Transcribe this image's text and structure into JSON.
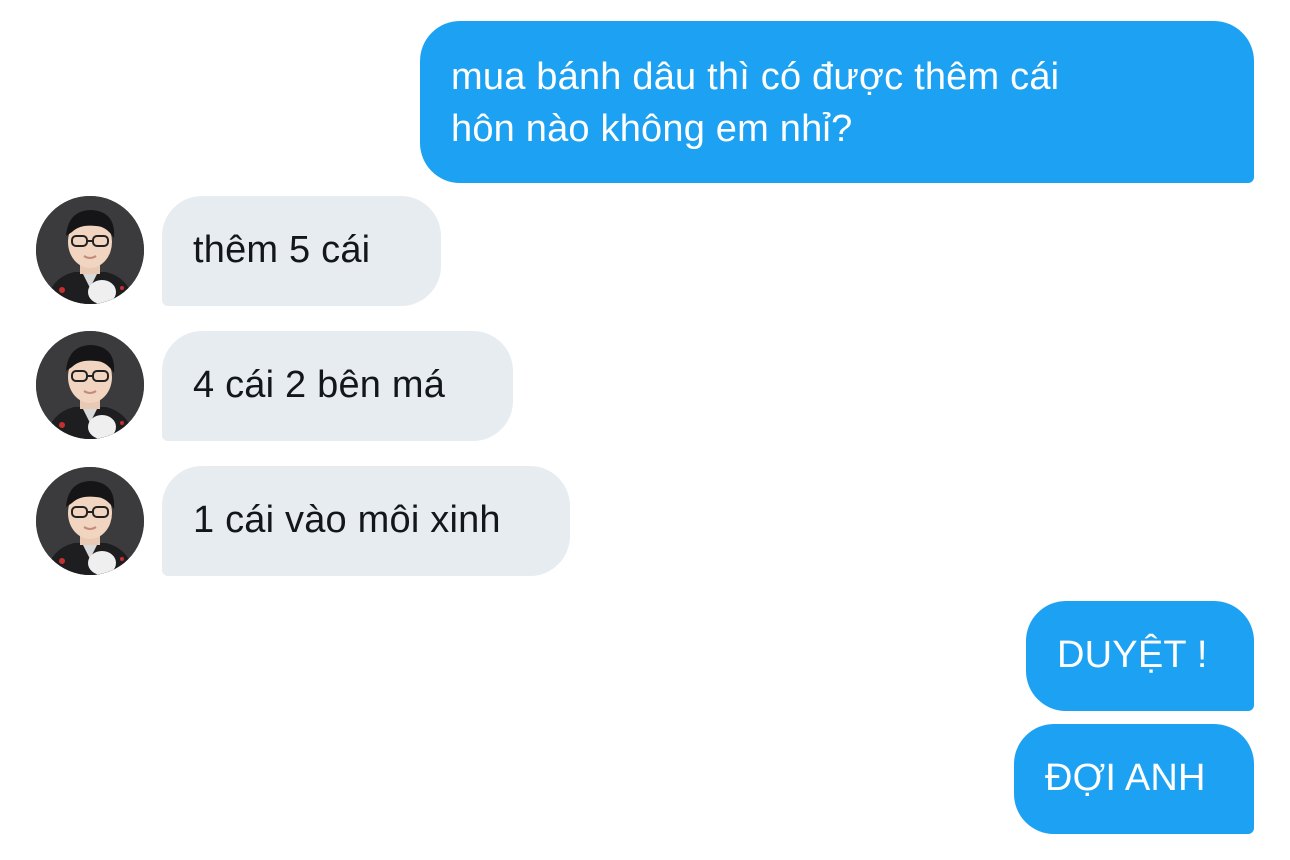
{
  "conversation": {
    "messages": [
      {
        "id": "m1",
        "sender": "me",
        "text_lines": [
          "mua bánh dâu thì có được thêm cái",
          "hôn nào không em nhỉ?"
        ]
      },
      {
        "id": "m2",
        "sender": "other",
        "text": "thêm 5 cái",
        "avatar_icon": "user-avatar"
      },
      {
        "id": "m3",
        "sender": "other",
        "text": "4 cái 2 bên má",
        "avatar_icon": "user-avatar"
      },
      {
        "id": "m4",
        "sender": "other",
        "text": "1 cái vào môi xinh",
        "avatar_icon": "user-avatar"
      },
      {
        "id": "m5",
        "sender": "me",
        "text": "DUYỆT !"
      },
      {
        "id": "m6",
        "sender": "me",
        "text": "ĐỢI ANH"
      }
    ]
  },
  "colors": {
    "sent_bubble": "#1da1f2",
    "received_bubble": "#e6ecf0",
    "sent_text": "#ffffff",
    "received_text": "#14171a",
    "background": "#ffffff"
  }
}
